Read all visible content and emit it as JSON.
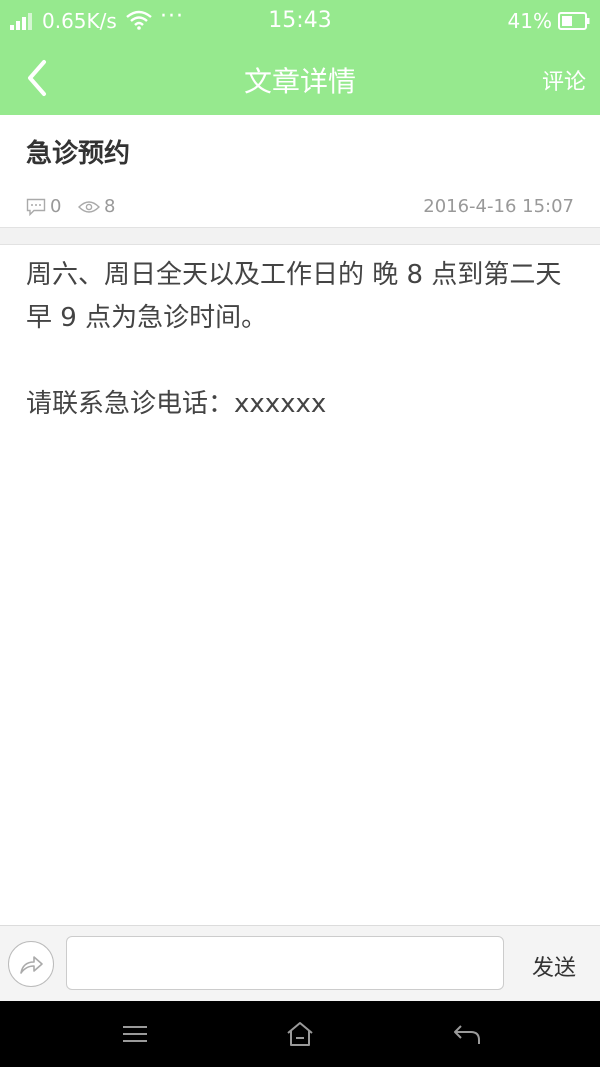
{
  "status_bar": {
    "network_speed": "0.65K/s",
    "more_dots": "···",
    "time": "15:43",
    "battery_percent": "41%"
  },
  "header": {
    "title": "文章详情",
    "comment_label": "评论"
  },
  "article": {
    "title": "急诊预约",
    "comment_count": "0",
    "view_count": "8",
    "date": "2016-4-16 15:07",
    "paragraphs": [
      "周六、周日全天以及工作日的 晚 8 点到第二天早 9 点为急诊时间。",
      "请联系急诊电话：xxxxxx"
    ]
  },
  "input_bar": {
    "placeholder": "",
    "send_label": "发送"
  },
  "icons": {
    "back": "chevron-left-icon",
    "share": "share-arrow-icon",
    "comment": "comment-bubble-icon",
    "views": "eye-icon",
    "nav_menu": "menu-icon",
    "nav_home": "home-icon",
    "nav_back": "return-icon"
  },
  "colors": {
    "header_green": "#96e98e",
    "text_dark": "#333333",
    "text_muted": "#999999"
  }
}
